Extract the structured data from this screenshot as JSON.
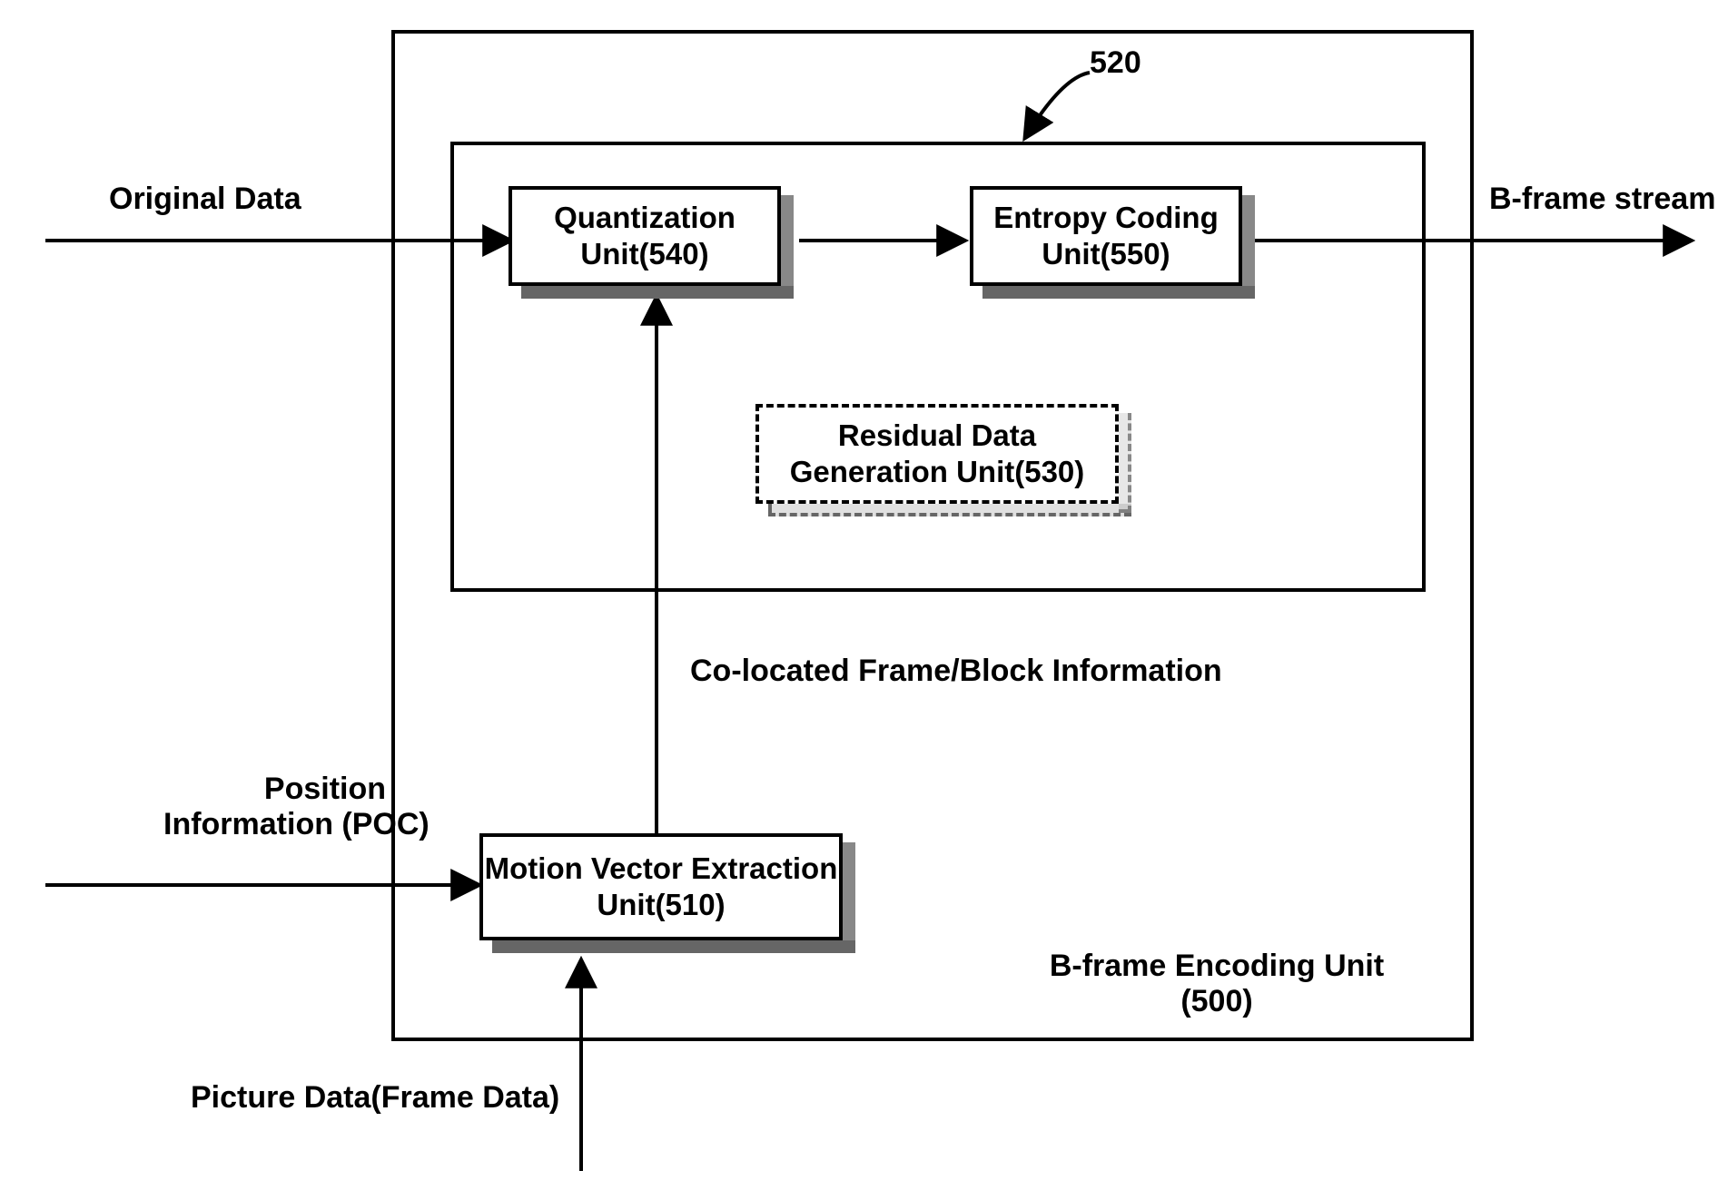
{
  "labels": {
    "original_data": "Original Data",
    "bframe_stream": "B-frame stream",
    "ref520": "520",
    "colocated": "Co-located Frame/Block Information",
    "position_info": "Position\nInformation (POC)",
    "picture_data": "Picture Data(Frame Data)",
    "outer_unit": "B-frame Encoding Unit\n(500)"
  },
  "blocks": {
    "quantization": "Quantization\nUnit(540)",
    "entropy": "Entropy Coding\nUnit(550)",
    "residual": "Residual Data\nGeneration Unit(530)",
    "motion": "Motion Vector\nExtraction Unit(510)"
  }
}
